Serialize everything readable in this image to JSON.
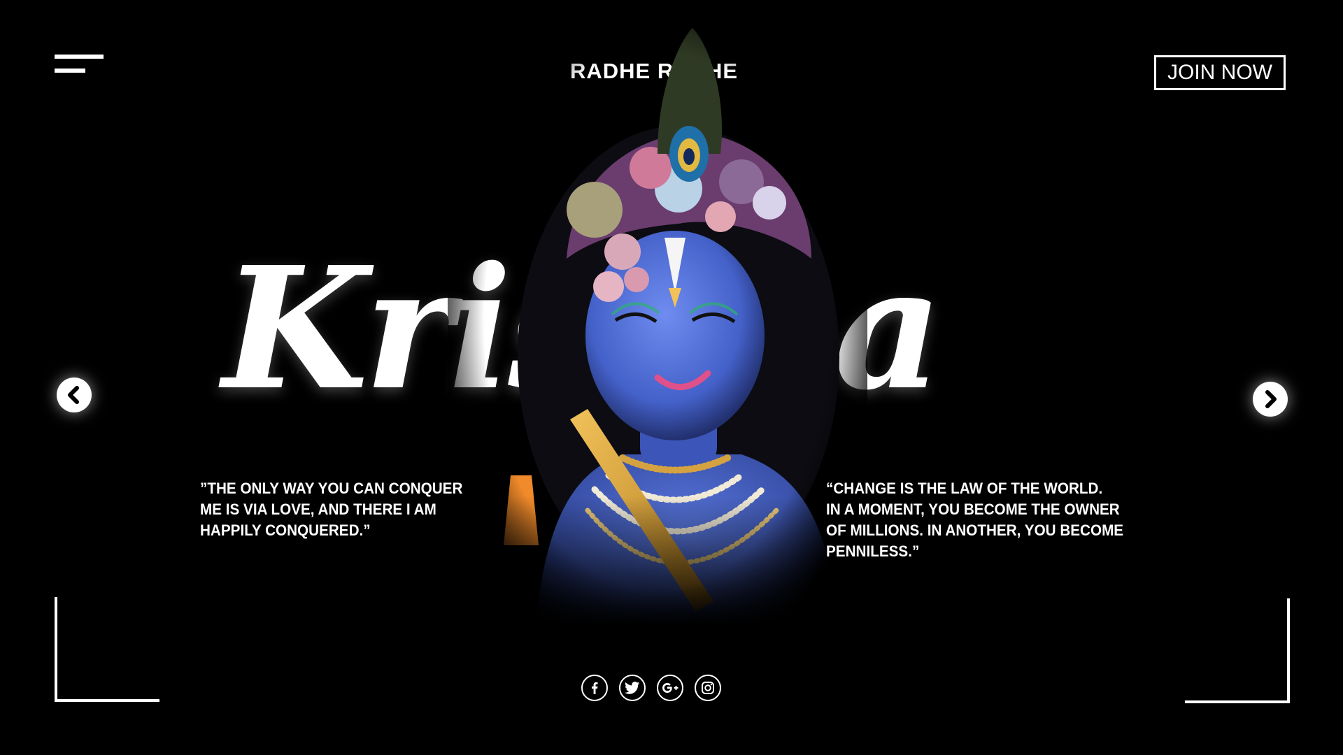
{
  "header": {
    "brand": "RADHE RADHE",
    "join_label": "JOIN NOW"
  },
  "hero": {
    "title": "Krishna",
    "quote_left": "”THE ONLY WAY YOU CAN CONQUER\n ME IS VIA LOVE, AND THERE I AM\nHAPPILY CONQUERED.”",
    "quote_right": "“CHANGE IS THE LAW OF THE WORLD.\nIN A MOMENT, YOU BECOME THE OWNER\nOF MILLIONS. IN ANOTHER, YOU BECOME\nPENNILESS.”"
  },
  "nav": {
    "prev_icon": "chevron-left-icon",
    "next_icon": "chevron-right-icon"
  },
  "social": [
    {
      "icon": "facebook-icon"
    },
    {
      "icon": "twitter-icon"
    },
    {
      "icon": "google-plus-icon"
    },
    {
      "icon": "instagram-icon"
    }
  ],
  "colors": {
    "background": "#000000",
    "foreground": "#ffffff",
    "skin": "#4f6fd6"
  }
}
